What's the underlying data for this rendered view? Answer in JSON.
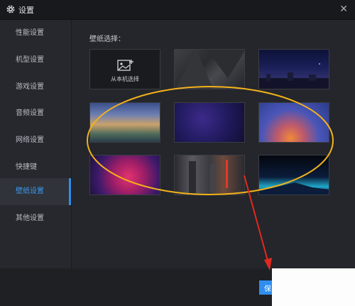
{
  "window": {
    "title": "设置",
    "close_symbol": "✕"
  },
  "sidebar": {
    "items": [
      {
        "label": "性能设置",
        "active": false
      },
      {
        "label": "机型设置",
        "active": false
      },
      {
        "label": "游戏设置",
        "active": false
      },
      {
        "label": "音频设置",
        "active": false
      },
      {
        "label": "网络设置",
        "active": false
      },
      {
        "label": "快捷键",
        "active": false
      },
      {
        "label": "壁纸设置",
        "active": true
      },
      {
        "label": "其他设置",
        "active": false
      }
    ]
  },
  "main": {
    "section_title": "壁纸选择：",
    "local_pick_label": "从本机选择",
    "wallpapers": [
      {
        "name": "local-pick",
        "icon": "image-add-icon"
      },
      {
        "name": "dark-geometric"
      },
      {
        "name": "night-city"
      },
      {
        "name": "anime-clouds"
      },
      {
        "name": "purple-bokeh"
      },
      {
        "name": "orange-gradient"
      },
      {
        "name": "neon-stage"
      },
      {
        "name": "city-lights"
      },
      {
        "name": "mountain-horizon"
      }
    ]
  },
  "footer": {
    "confirm_label": "保"
  },
  "colors": {
    "accent": "#2f8ef0",
    "highlight_ellipse": "#f3b21b",
    "annotation_arrow": "#e0291f"
  }
}
